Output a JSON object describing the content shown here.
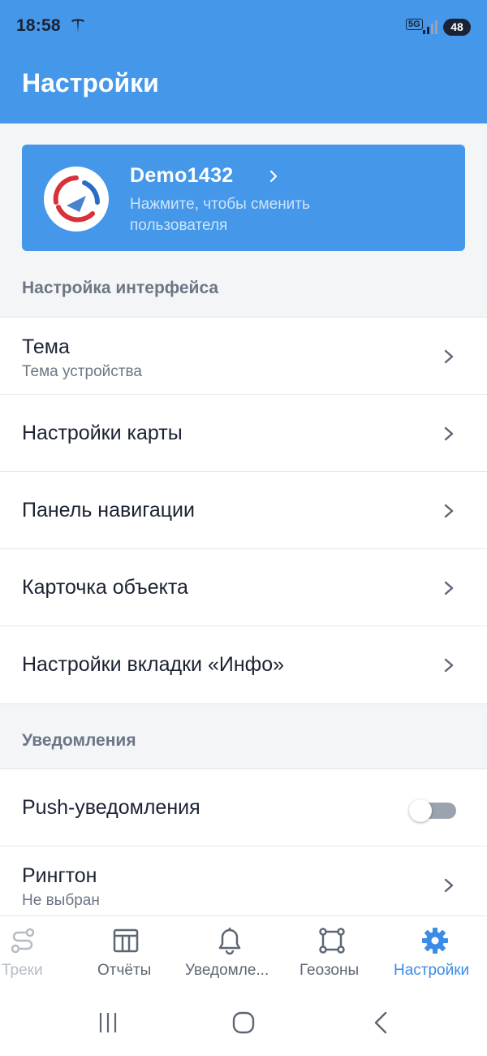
{
  "status_bar": {
    "time": "18:58",
    "network": "5G",
    "battery": "48",
    "icons": [
      "tesla-icon",
      "signal-icon"
    ]
  },
  "header": {
    "title": "Настройки"
  },
  "profile": {
    "username": "Demo1432",
    "hint": "Нажмите, чтобы сменить пользователя"
  },
  "sections": {
    "interface": {
      "title": "Настройка интерфейса",
      "items": [
        {
          "title": "Тема",
          "subtitle": "Тема устройства"
        },
        {
          "title": "Настройки карты"
        },
        {
          "title": "Панель навигации"
        },
        {
          "title": "Карточка объекта"
        },
        {
          "title": "Настройки вкладки «Инфо»"
        }
      ]
    },
    "notifications": {
      "title": "Уведомления",
      "items": [
        {
          "title": "Push-уведомления",
          "toggle": false
        },
        {
          "title": "Рингтон",
          "subtitle": "Не выбран"
        }
      ]
    }
  },
  "tabs": [
    {
      "label": "Треки",
      "icon": "route-icon",
      "active": false
    },
    {
      "label": "Отчёты",
      "icon": "table-icon",
      "active": false
    },
    {
      "label": "Уведомле...",
      "icon": "bell-icon",
      "active": false
    },
    {
      "label": "Геозоны",
      "icon": "polygon-icon",
      "active": false
    },
    {
      "label": "Настройки",
      "icon": "gear-icon",
      "active": true
    }
  ],
  "colors": {
    "primary": "#4497e9",
    "active_tab": "#3b8ce6",
    "text": "#1b2233",
    "muted": "#6c7684",
    "background": "#f4f5f7"
  }
}
